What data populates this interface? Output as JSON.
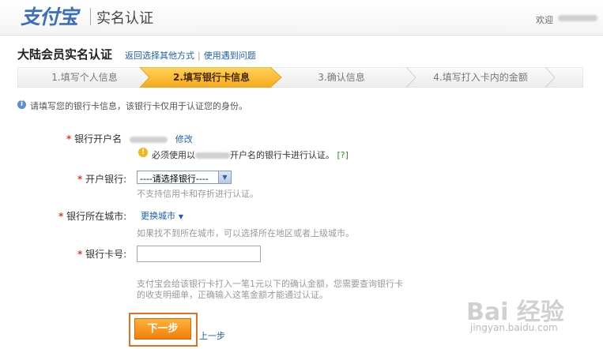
{
  "header": {
    "logo_text": "支付宝",
    "title": "实名认证",
    "welcome": "欢迎"
  },
  "page": {
    "title": "大陆会员实名认证",
    "link_back": "返回选择其他方式",
    "link_sep": "|",
    "link_help": "使用遇到问题"
  },
  "steps": [
    {
      "label": "1.填写个人信息",
      "active": false
    },
    {
      "label": "2.填写银行卡信息",
      "active": true
    },
    {
      "label": "3.确认信息",
      "active": false
    },
    {
      "label": "4.填写打入卡内的金额",
      "active": false
    }
  ],
  "notice": "请填写您的银行卡信息，该银行卡仅用于认证您的身份。",
  "form": {
    "account_name_label": "银行开户名",
    "account_name_edit": "修改",
    "account_name_warning_prefix": "必须使用以",
    "account_name_warning_suffix": "开户名的银行卡进行认证。",
    "help_mark": "[?]",
    "bank_label": "开户银行:",
    "bank_select_value": "----请选择银行----",
    "bank_hint": "不支持信用卡和存折进行认证。",
    "city_label": "银行所在城市:",
    "city_change": "更换城市",
    "city_hint": "如果找不到所在城市，可以选择所在地区或者上级城市。",
    "card_label": "银行卡号:",
    "card_value": "",
    "card_hint_line1": "支付宝会给该银行卡打入一笔1元以下的确认金额，您需要查询银行卡",
    "card_hint_line2": "的收支明细单，正确输入这笔金额才能通过认证。",
    "next_button": "下一步",
    "prev_link": "上一步"
  },
  "watermark": {
    "brand": "Bai  经验",
    "url": "jingyan.baidu.com"
  },
  "colors": {
    "accent_orange": "#f7a41d",
    "link_blue": "#1a5fb4",
    "required_red": "#e03c2c"
  }
}
